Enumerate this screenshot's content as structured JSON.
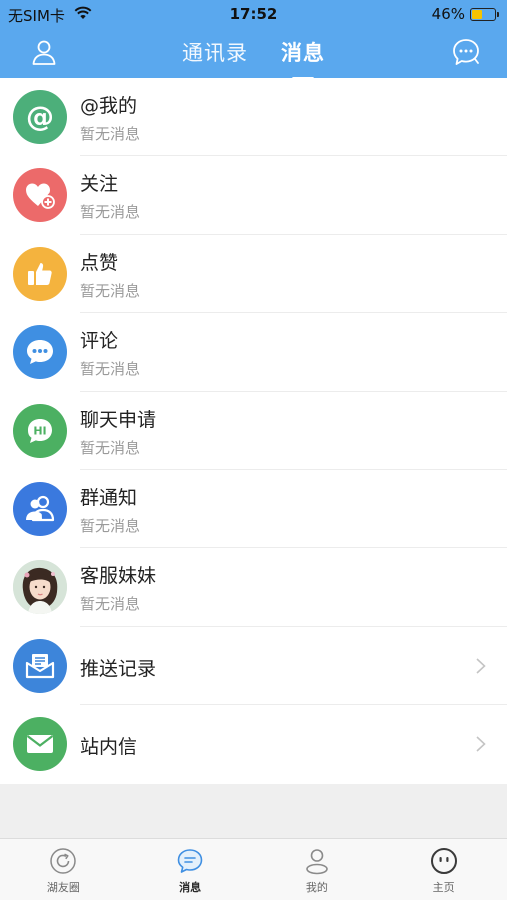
{
  "status": {
    "carrier": "无SIM卡",
    "time": "17:52",
    "battery": "46%",
    "battery_level": 0.46
  },
  "nav": {
    "tabs": [
      {
        "label": "通讯录",
        "active": false
      },
      {
        "label": "消息",
        "active": true
      }
    ],
    "left_icon": "profile-icon",
    "right_icon": "chat-bubble-icon"
  },
  "list": {
    "items": [
      {
        "title": "@我的",
        "subtitle": "暂无消息",
        "icon": "at-icon",
        "color": "#4caf7a"
      },
      {
        "title": "关注",
        "subtitle": "暂无消息",
        "icon": "heart-plus-icon",
        "color": "#ec6a6a"
      },
      {
        "title": "点赞",
        "subtitle": "暂无消息",
        "icon": "thumbs-up-icon",
        "color": "#f4b33e"
      },
      {
        "title": "评论",
        "subtitle": "暂无消息",
        "icon": "comment-icon",
        "color": "#3f8fe2"
      },
      {
        "title": "聊天申请",
        "subtitle": "暂无消息",
        "icon": "hi-chat-icon",
        "color": "#4cb062"
      },
      {
        "title": "群通知",
        "subtitle": "暂无消息",
        "icon": "group-icon",
        "color": "#3a79de"
      },
      {
        "title": "客服妹妹",
        "subtitle": "暂无消息",
        "icon": "customer-service-avatar",
        "color": "#dfe9e0"
      },
      {
        "title": "推送记录",
        "icon": "push-record-icon",
        "color": "#3d85da"
      },
      {
        "title": "站内信",
        "icon": "mail-icon",
        "color": "#4cb062"
      }
    ]
  },
  "tabbar": {
    "items": [
      {
        "label": "湖友圈",
        "icon": "refresh-circle-icon",
        "active": false
      },
      {
        "label": "消息",
        "icon": "message-icon",
        "active": true
      },
      {
        "label": "我的",
        "icon": "person-icon",
        "active": false
      },
      {
        "label": "主页",
        "icon": "home-face-icon",
        "active": false
      }
    ]
  }
}
